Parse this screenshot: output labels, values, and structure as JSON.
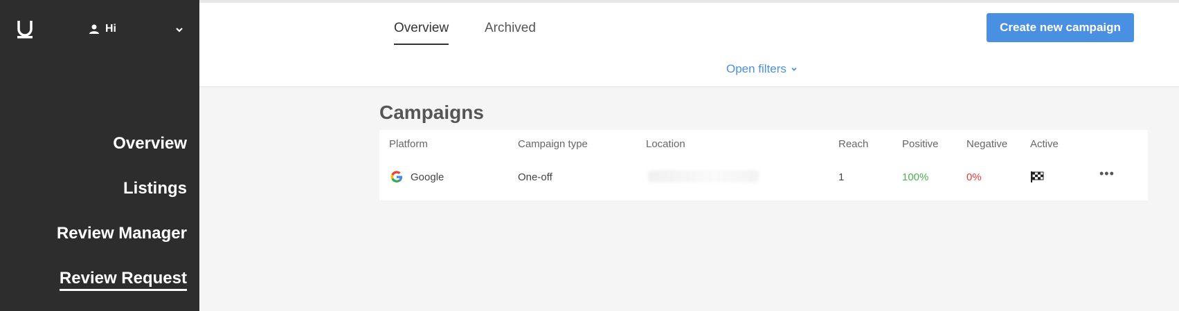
{
  "sidebar": {
    "user_greeting": "Hi",
    "nav": [
      {
        "label": "Overview"
      },
      {
        "label": "Listings"
      },
      {
        "label": "Review Manager"
      },
      {
        "label": "Review Request",
        "active": true
      }
    ]
  },
  "header": {
    "tabs": [
      {
        "label": "Overview",
        "active": true
      },
      {
        "label": "Archived"
      }
    ],
    "create_button": "Create new campaign",
    "open_filters": "Open filters"
  },
  "main": {
    "title": "Campaigns",
    "columns": [
      "Platform",
      "Campaign type",
      "Location",
      "Reach",
      "Positive",
      "Negative",
      "Active"
    ],
    "rows": [
      {
        "platform": "Google",
        "campaign_type": "One-off",
        "reach": "1",
        "positive": "100%",
        "negative": "0%"
      }
    ]
  },
  "colors": {
    "sidebar_bg": "#2d2d2d",
    "accent": "#4a90e2",
    "positive": "#4caf50",
    "negative": "#e53935"
  },
  "icons": [
    "logo-icon",
    "user-icon",
    "chevron-down-icon",
    "google-icon",
    "checkered-flag-icon",
    "more-options-icon"
  ]
}
